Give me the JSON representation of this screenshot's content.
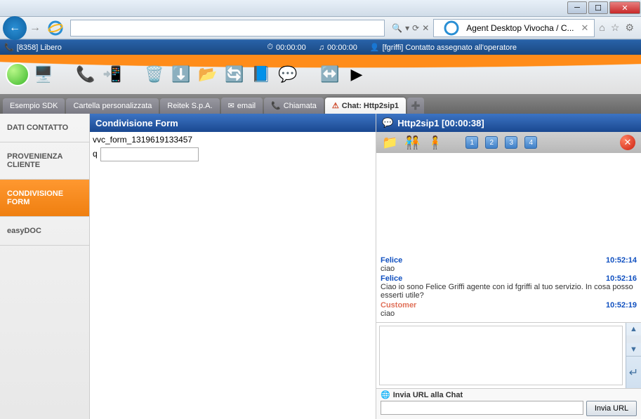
{
  "browser": {
    "tab_title": "Agent Desktop Vivocha / C...",
    "search_placeholder": ""
  },
  "status": {
    "agent_id": "[8358] Libero",
    "timer1": "00:00:00",
    "timer2": "00:00:00",
    "message": "[fgriffi] Contatto assegnato all'operatore"
  },
  "tabs": [
    {
      "label": "Esempio SDK"
    },
    {
      "label": "Cartella personalizzata"
    },
    {
      "label": "Reitek S.p.A."
    },
    {
      "label": "email"
    },
    {
      "label": "Chiamata"
    },
    {
      "label": "Chat: Http2sip1"
    }
  ],
  "sidenav": [
    {
      "label": "DATI CONTATTO"
    },
    {
      "label": "PROVENIENZA CLIENTE"
    },
    {
      "label": "CONDIVISIONE FORM"
    },
    {
      "label": "easyDOC"
    }
  ],
  "form_panel": {
    "title": "Condivisione Form",
    "form_name": "vvc_form_1319619133457",
    "field_label": "q",
    "field_value": ""
  },
  "chat_panel": {
    "title": "Http2sip1 [00:00:38]",
    "num_buttons": [
      "1",
      "2",
      "3",
      "4"
    ],
    "messages": [
      {
        "sender": "Felice",
        "kind": "agent",
        "time": "10:52:14",
        "text": "ciao"
      },
      {
        "sender": "Felice",
        "kind": "agent",
        "time": "10:52:16",
        "text": "Ciao io sono Felice Griffi agente con id fgriffi al tuo servizio. In cosa posso esserti utile?"
      },
      {
        "sender": "Customer",
        "kind": "cust",
        "time": "10:52:19",
        "text": "ciao"
      }
    ],
    "url_label": "Invia URL alla Chat",
    "url_value": "",
    "url_button": "Invia URL"
  }
}
